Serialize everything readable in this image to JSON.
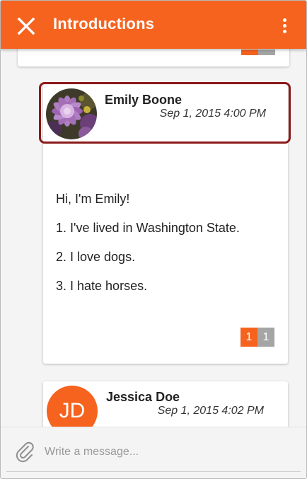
{
  "header": {
    "title": "Introductions",
    "close_icon": "close-icon",
    "menu_icon": "more-vertical-icon",
    "color": "#f5631f"
  },
  "previous_entry": {
    "badge_colors": [
      "#f5631f",
      "#a5a5a5"
    ]
  },
  "entries": [
    {
      "author": "Emily Boone",
      "date": "Sep 1, 2015 4:00 PM",
      "avatar": "flower-photo-avatar",
      "highlighted": true,
      "highlight_color": "#8b1a1a",
      "body": [
        "Hi, I'm Emily!",
        "1. I've lived in Washington State.",
        "2. I love dogs.",
        "3. I hate horses."
      ],
      "badges": [
        "1",
        "1"
      ]
    },
    {
      "author": "Jessica Doe",
      "date": "Sep 1, 2015 4:02 PM",
      "avatar_initials": "JD"
    }
  ],
  "composer": {
    "placeholder": "Write a message...",
    "attach_icon": "paperclip-icon"
  }
}
